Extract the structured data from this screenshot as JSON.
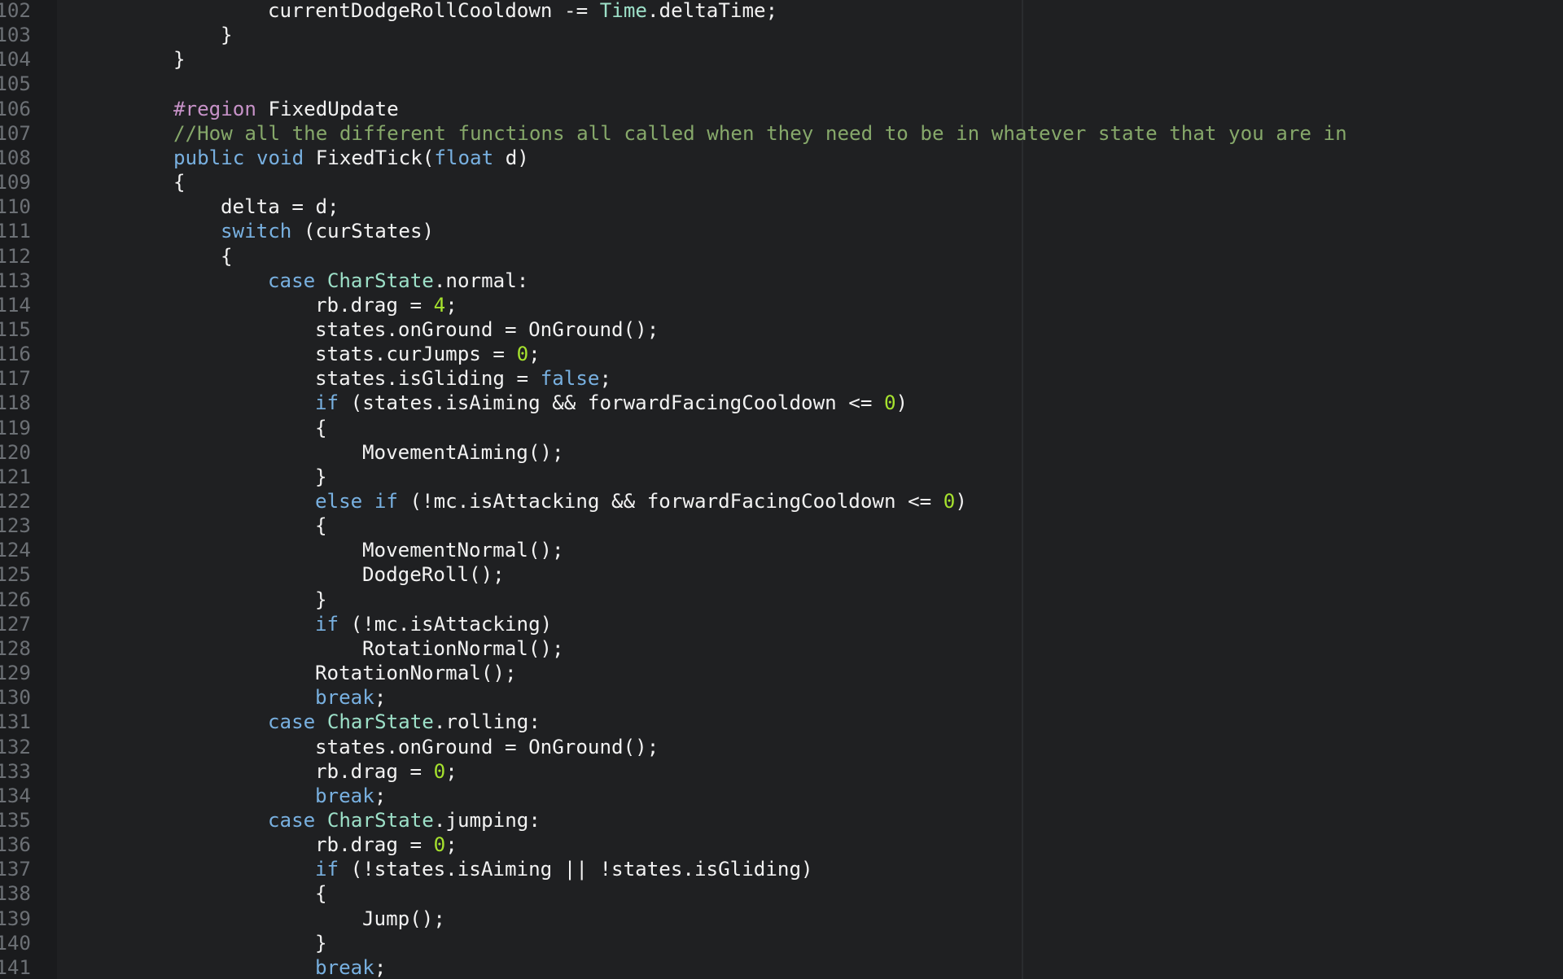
{
  "editor": {
    "colors": {
      "background": "#1f2022",
      "gutter": "#1a1b1d",
      "line_number": "#6c7075",
      "plain": "#f2f2f2",
      "keyword": "#78b0e0",
      "type": "#9de0c8",
      "number": "#a6e22e",
      "comment": "#86a86a",
      "preprocessor": "#c792c8"
    },
    "lines": [
      {
        "num": "102",
        "indent": 3,
        "tokens": [
          {
            "t": "currentDodgeRollCooldown -= ",
            "c": "plain"
          },
          {
            "t": "Time",
            "c": "type"
          },
          {
            "t": ".deltaTime;",
            "c": "plain"
          }
        ]
      },
      {
        "num": "103",
        "indent": 2,
        "tokens": [
          {
            "t": "}",
            "c": "plain"
          }
        ]
      },
      {
        "num": "104",
        "indent": 1,
        "tokens": [
          {
            "t": "}",
            "c": "plain"
          }
        ]
      },
      {
        "num": "105",
        "indent": 0,
        "tokens": []
      },
      {
        "num": "106",
        "indent": 1,
        "tokens": [
          {
            "t": "#region",
            "c": "pre"
          },
          {
            "t": " FixedUpdate",
            "c": "plain"
          }
        ]
      },
      {
        "num": "107",
        "indent": 1,
        "tokens": [
          {
            "t": "//How all the different functions all called when they need to be in whatever state that you are in",
            "c": "comment"
          }
        ]
      },
      {
        "num": "108",
        "indent": 1,
        "tokens": [
          {
            "t": "public",
            "c": "keyword"
          },
          {
            "t": " ",
            "c": "plain"
          },
          {
            "t": "void",
            "c": "keyword"
          },
          {
            "t": " FixedTick(",
            "c": "plain"
          },
          {
            "t": "float",
            "c": "keyword"
          },
          {
            "t": " d)",
            "c": "plain"
          }
        ]
      },
      {
        "num": "109",
        "indent": 1,
        "tokens": [
          {
            "t": "{",
            "c": "plain"
          }
        ]
      },
      {
        "num": "110",
        "indent": 2,
        "tokens": [
          {
            "t": "delta = d;",
            "c": "plain"
          }
        ]
      },
      {
        "num": "111",
        "indent": 2,
        "tokens": [
          {
            "t": "switch",
            "c": "keyword"
          },
          {
            "t": " (curStates)",
            "c": "plain"
          }
        ]
      },
      {
        "num": "112",
        "indent": 2,
        "tokens": [
          {
            "t": "{",
            "c": "plain"
          }
        ]
      },
      {
        "num": "113",
        "indent": 3,
        "tokens": [
          {
            "t": "case",
            "c": "keyword"
          },
          {
            "t": " ",
            "c": "plain"
          },
          {
            "t": "CharState",
            "c": "type"
          },
          {
            "t": ".normal:",
            "c": "plain"
          }
        ]
      },
      {
        "num": "114",
        "indent": 4,
        "tokens": [
          {
            "t": "rb.drag = ",
            "c": "plain"
          },
          {
            "t": "4",
            "c": "number"
          },
          {
            "t": ";",
            "c": "plain"
          }
        ]
      },
      {
        "num": "115",
        "indent": 4,
        "tokens": [
          {
            "t": "states.onGround = OnGround();",
            "c": "plain"
          }
        ]
      },
      {
        "num": "116",
        "indent": 4,
        "tokens": [
          {
            "t": "stats.curJumps = ",
            "c": "plain"
          },
          {
            "t": "0",
            "c": "number"
          },
          {
            "t": ";",
            "c": "plain"
          }
        ]
      },
      {
        "num": "117",
        "indent": 4,
        "tokens": [
          {
            "t": "states.isGliding = ",
            "c": "plain"
          },
          {
            "t": "false",
            "c": "keyword"
          },
          {
            "t": ";",
            "c": "plain"
          }
        ]
      },
      {
        "num": "118",
        "indent": 4,
        "tokens": [
          {
            "t": "if",
            "c": "keyword"
          },
          {
            "t": " (states.isAiming && forwardFacingCooldown <= ",
            "c": "plain"
          },
          {
            "t": "0",
            "c": "number"
          },
          {
            "t": ")",
            "c": "plain"
          }
        ]
      },
      {
        "num": "119",
        "indent": 4,
        "tokens": [
          {
            "t": "{",
            "c": "plain"
          }
        ]
      },
      {
        "num": "120",
        "indent": 5,
        "tokens": [
          {
            "t": "MovementAiming();",
            "c": "plain"
          }
        ]
      },
      {
        "num": "121",
        "indent": 4,
        "tokens": [
          {
            "t": "}",
            "c": "plain"
          }
        ]
      },
      {
        "num": "122",
        "indent": 4,
        "tokens": [
          {
            "t": "else",
            "c": "keyword"
          },
          {
            "t": " ",
            "c": "plain"
          },
          {
            "t": "if",
            "c": "keyword"
          },
          {
            "t": " (!mc.isAttacking && forwardFacingCooldown <= ",
            "c": "plain"
          },
          {
            "t": "0",
            "c": "number"
          },
          {
            "t": ")",
            "c": "plain"
          }
        ]
      },
      {
        "num": "123",
        "indent": 4,
        "tokens": [
          {
            "t": "{",
            "c": "plain"
          }
        ]
      },
      {
        "num": "124",
        "indent": 5,
        "tokens": [
          {
            "t": "MovementNormal();",
            "c": "plain"
          }
        ]
      },
      {
        "num": "125",
        "indent": 5,
        "tokens": [
          {
            "t": "DodgeRoll();",
            "c": "plain"
          }
        ]
      },
      {
        "num": "126",
        "indent": 4,
        "tokens": [
          {
            "t": "}",
            "c": "plain"
          }
        ]
      },
      {
        "num": "127",
        "indent": 4,
        "tokens": [
          {
            "t": "if",
            "c": "keyword"
          },
          {
            "t": " (!mc.isAttacking)",
            "c": "plain"
          }
        ]
      },
      {
        "num": "128",
        "indent": 5,
        "tokens": [
          {
            "t": "RotationNormal();",
            "c": "plain"
          }
        ]
      },
      {
        "num": "129",
        "indent": 4,
        "tokens": [
          {
            "t": "RotationNormal();",
            "c": "plain"
          }
        ]
      },
      {
        "num": "130",
        "indent": 4,
        "tokens": [
          {
            "t": "break",
            "c": "keyword"
          },
          {
            "t": ";",
            "c": "plain"
          }
        ]
      },
      {
        "num": "131",
        "indent": 3,
        "tokens": [
          {
            "t": "case",
            "c": "keyword"
          },
          {
            "t": " ",
            "c": "plain"
          },
          {
            "t": "CharState",
            "c": "type"
          },
          {
            "t": ".rolling:",
            "c": "plain"
          }
        ]
      },
      {
        "num": "132",
        "indent": 4,
        "tokens": [
          {
            "t": "states.onGround = OnGround();",
            "c": "plain"
          }
        ]
      },
      {
        "num": "133",
        "indent": 4,
        "tokens": [
          {
            "t": "rb.drag = ",
            "c": "plain"
          },
          {
            "t": "0",
            "c": "number"
          },
          {
            "t": ";",
            "c": "plain"
          }
        ]
      },
      {
        "num": "134",
        "indent": 4,
        "tokens": [
          {
            "t": "break",
            "c": "keyword"
          },
          {
            "t": ";",
            "c": "plain"
          }
        ]
      },
      {
        "num": "135",
        "indent": 3,
        "tokens": [
          {
            "t": "case",
            "c": "keyword"
          },
          {
            "t": " ",
            "c": "plain"
          },
          {
            "t": "CharState",
            "c": "type"
          },
          {
            "t": ".jumping:",
            "c": "plain"
          }
        ]
      },
      {
        "num": "136",
        "indent": 4,
        "tokens": [
          {
            "t": "rb.drag = ",
            "c": "plain"
          },
          {
            "t": "0",
            "c": "number"
          },
          {
            "t": ";",
            "c": "plain"
          }
        ]
      },
      {
        "num": "137",
        "indent": 4,
        "tokens": [
          {
            "t": "if",
            "c": "keyword"
          },
          {
            "t": " (!states.isAiming || !states.isGliding)",
            "c": "plain"
          }
        ]
      },
      {
        "num": "138",
        "indent": 4,
        "tokens": [
          {
            "t": "{",
            "c": "plain"
          }
        ]
      },
      {
        "num": "139",
        "indent": 5,
        "tokens": [
          {
            "t": "Jump();",
            "c": "plain"
          }
        ]
      },
      {
        "num": "140",
        "indent": 4,
        "tokens": [
          {
            "t": "}",
            "c": "plain"
          }
        ]
      },
      {
        "num": "141",
        "indent": 4,
        "tokens": [
          {
            "t": "break",
            "c": "keyword"
          },
          {
            "t": ";",
            "c": "plain"
          }
        ]
      }
    ]
  }
}
